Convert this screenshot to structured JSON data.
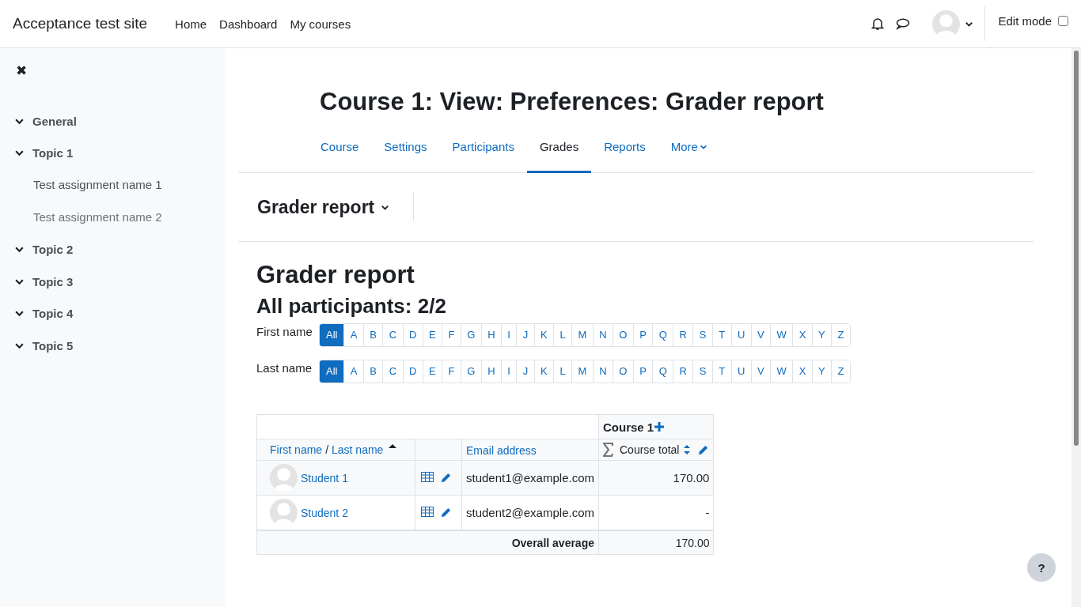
{
  "navbar": {
    "site_name": "Acceptance test site",
    "links": [
      "Home",
      "Dashboard",
      "My courses"
    ],
    "edit_mode": {
      "label": "Edit mode",
      "checked": false
    }
  },
  "sidebar": {
    "close": "✖",
    "sections": [
      {
        "title": "General",
        "expanded": true
      },
      {
        "title": "Topic 1",
        "expanded": true,
        "children": [
          {
            "title": "Test assignment name 1",
            "dimmed": false
          },
          {
            "title": "Test assignment name 2",
            "dimmed": true
          }
        ]
      },
      {
        "title": "Topic 2",
        "expanded": true
      },
      {
        "title": "Topic 3",
        "expanded": true
      },
      {
        "title": "Topic 4",
        "expanded": true
      },
      {
        "title": "Topic 5",
        "expanded": true
      }
    ]
  },
  "page_title": "Course 1: View: Preferences: Grader report",
  "tabs": [
    {
      "label": "Course",
      "selected": false
    },
    {
      "label": "Settings",
      "selected": false
    },
    {
      "label": "Participants",
      "selected": false
    },
    {
      "label": "Grades",
      "selected": true
    },
    {
      "label": "Reports",
      "selected": false
    },
    {
      "label": "More",
      "selected": false,
      "kind": "dropdown"
    }
  ],
  "report_selector": "Grader report",
  "heading": "Grader report",
  "subheading": "All participants: 2/2",
  "initials_bars": [
    {
      "label": "First name",
      "letters": [
        {
          "text": "All",
          "selected": true
        },
        {
          "text": "A",
          "selected": false
        },
        {
          "text": "B",
          "selected": false
        },
        {
          "text": "C",
          "selected": false
        },
        {
          "text": "D",
          "selected": false
        },
        {
          "text": "E",
          "selected": false
        },
        {
          "text": "F",
          "selected": false
        },
        {
          "text": "G",
          "selected": false
        },
        {
          "text": "H",
          "selected": false
        },
        {
          "text": "I",
          "selected": false
        },
        {
          "text": "J",
          "selected": false
        },
        {
          "text": "K",
          "selected": false
        },
        {
          "text": "L",
          "selected": false
        },
        {
          "text": "M",
          "selected": false
        },
        {
          "text": "N",
          "selected": false
        },
        {
          "text": "O",
          "selected": false
        },
        {
          "text": "P",
          "selected": false
        },
        {
          "text": "Q",
          "selected": false
        },
        {
          "text": "R",
          "selected": false
        },
        {
          "text": "S",
          "selected": false
        },
        {
          "text": "T",
          "selected": false
        },
        {
          "text": "U",
          "selected": false
        },
        {
          "text": "V",
          "selected": false
        },
        {
          "text": "W",
          "selected": false
        },
        {
          "text": "X",
          "selected": false
        },
        {
          "text": "Y",
          "selected": false
        },
        {
          "text": "Z",
          "selected": false
        }
      ]
    },
    {
      "label": "Last name",
      "letters": [
        {
          "text": "All",
          "selected": true
        },
        {
          "text": "A",
          "selected": false
        },
        {
          "text": "B",
          "selected": false
        },
        {
          "text": "C",
          "selected": false
        },
        {
          "text": "D",
          "selected": false
        },
        {
          "text": "E",
          "selected": false
        },
        {
          "text": "F",
          "selected": false
        },
        {
          "text": "G",
          "selected": false
        },
        {
          "text": "H",
          "selected": false
        },
        {
          "text": "I",
          "selected": false
        },
        {
          "text": "J",
          "selected": false
        },
        {
          "text": "K",
          "selected": false
        },
        {
          "text": "L",
          "selected": false
        },
        {
          "text": "M",
          "selected": false
        },
        {
          "text": "N",
          "selected": false
        },
        {
          "text": "O",
          "selected": false
        },
        {
          "text": "P",
          "selected": false
        },
        {
          "text": "Q",
          "selected": false
        },
        {
          "text": "R",
          "selected": false
        },
        {
          "text": "S",
          "selected": false
        },
        {
          "text": "T",
          "selected": false
        },
        {
          "text": "U",
          "selected": false
        },
        {
          "text": "V",
          "selected": false
        },
        {
          "text": "W",
          "selected": false
        },
        {
          "text": "X",
          "selected": false
        },
        {
          "text": "Y",
          "selected": false
        },
        {
          "text": "Z",
          "selected": false
        }
      ]
    }
  ],
  "table": {
    "category": "Course 1",
    "columns": {
      "first_name": "First name",
      "separator": "/",
      "last_name": "Last name",
      "email": "Email address",
      "total": "Course total"
    },
    "rows": [
      {
        "name": "Student 1",
        "email": "student1@example.com",
        "total": "170.00"
      },
      {
        "name": "Student 2",
        "email": "student2@example.com",
        "total": "-"
      }
    ],
    "average": {
      "label": "Overall average",
      "value": "170.00"
    }
  },
  "help_button": "?"
}
